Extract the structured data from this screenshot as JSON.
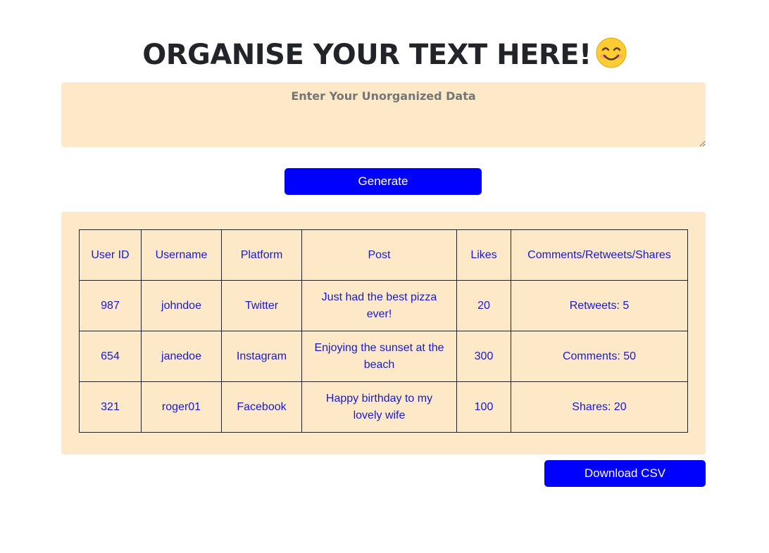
{
  "header": {
    "title": "ORGANISE YOUR TEXT HERE!",
    "emoji_icon": "smiling-face-emoji"
  },
  "input": {
    "placeholder": "Enter Your Unorganized Data",
    "value": ""
  },
  "actions": {
    "generate_label": "Generate",
    "download_label": "Download CSV"
  },
  "colors": {
    "accent": "#0000ff",
    "panel_bg": "#fde9c7",
    "table_text": "#1a1ac8"
  },
  "table": {
    "headers": [
      "User ID",
      "Username",
      "Platform",
      "Post",
      "Likes",
      "Comments/Retweets/Shares"
    ],
    "rows": [
      [
        "987",
        "johndoe",
        "Twitter",
        "Just had the best pizza ever!",
        "20",
        "Retweets: 5"
      ],
      [
        "654",
        "janedoe",
        "Instagram",
        "Enjoying the sunset at the beach",
        "300",
        "Comments: 50"
      ],
      [
        "321",
        "roger01",
        "Facebook",
        "Happy birthday to my lovely wife",
        "100",
        "Shares: 20"
      ]
    ]
  }
}
